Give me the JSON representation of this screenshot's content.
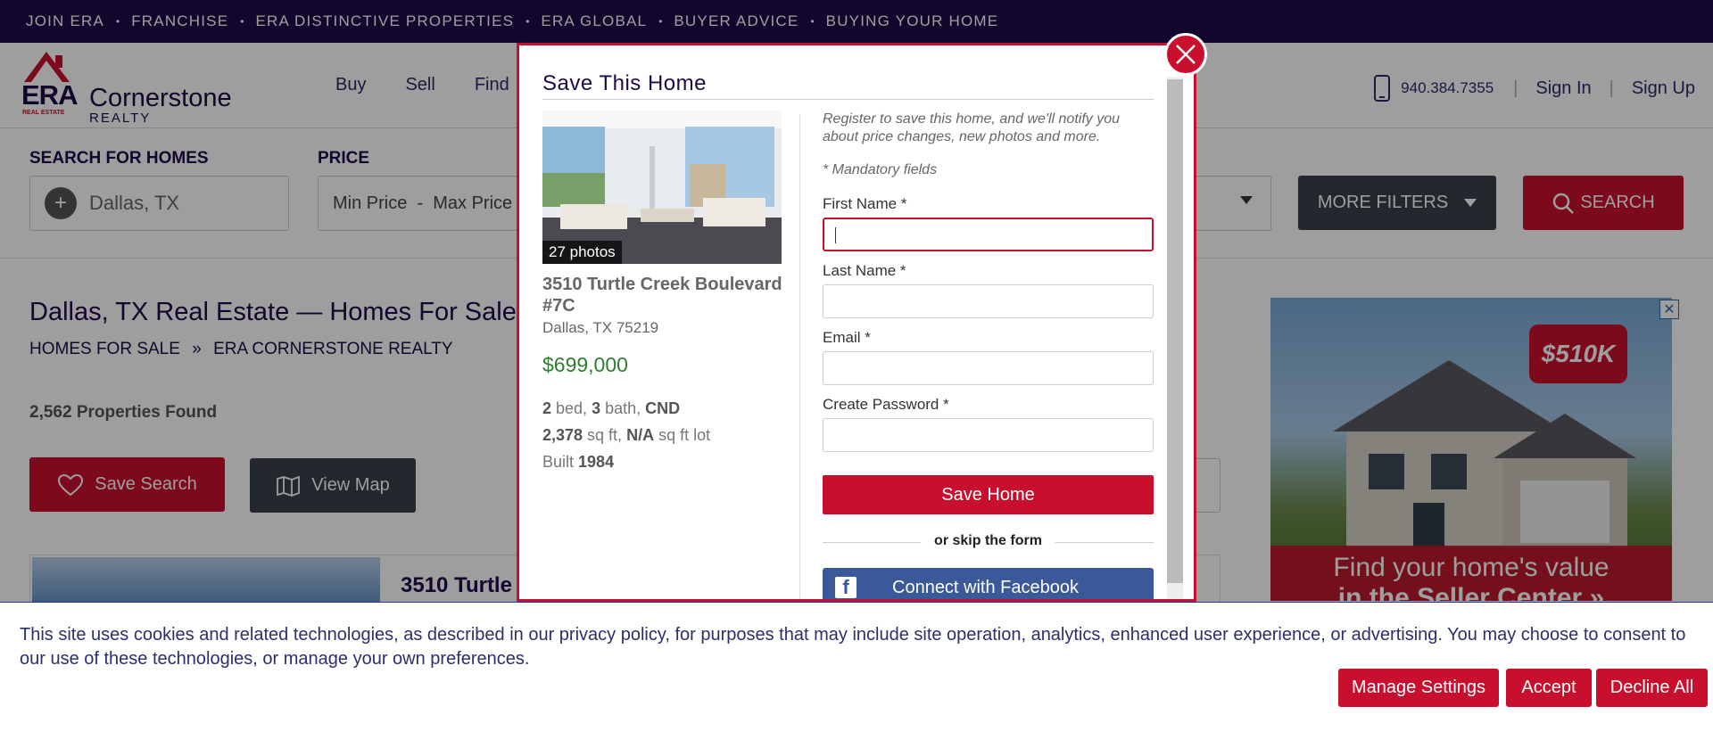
{
  "topbar": {
    "items": [
      "JOIN ERA",
      "FRANCHISE",
      "ERA DISTINCTIVE PROPERTIES",
      "ERA GLOBAL",
      "BUYER ADVICE",
      "BUYING YOUR HOME"
    ]
  },
  "header": {
    "logo_brand": "ERA",
    "logo_sub": "REAL ESTATE",
    "logo_name": "Cornerstone",
    "logo_realty": "REALTY",
    "nav": [
      "Buy",
      "Sell",
      "Find"
    ],
    "phone": "940.384.7355",
    "sign_in": "Sign In",
    "sign_up": "Sign Up"
  },
  "search": {
    "location_label": "SEARCH FOR HOMES",
    "location_value": "Dallas, TX",
    "price_label": "PRICE",
    "price_value": "Min Price  -  Max Price",
    "more_filters": "MORE FILTERS",
    "search_button": "SEARCH"
  },
  "results": {
    "title": "Dallas, TX Real Estate — Homes For Sale",
    "crumb1": "HOMES FOR SALE",
    "crumb_sep": "»",
    "crumb2": "ERA CORNERSTONE REALTY",
    "count": "2,562 Properties Found",
    "save_search": "Save Search",
    "view_map": "View Map",
    "card_title": "3510 Turtle"
  },
  "ad": {
    "price_tag": "$510K",
    "line1": "Find your home's value",
    "line2": "in the Seller Center »",
    "close": "✕"
  },
  "modal": {
    "title": "Save This Home",
    "photo_count": "27 photos",
    "address": "3510 Turtle Creek Boulevard #7C",
    "city": "Dallas, TX 75219",
    "price": "$699,000",
    "beds": "2",
    "beds_label": " bed, ",
    "baths": "3",
    "baths_label": " bath, ",
    "type": "CND",
    "sqft": "2,378",
    "sqft_label": " sq ft, ",
    "lot": "N/A",
    "lot_label": " sq ft lot",
    "built_label": "Built ",
    "built": "1984",
    "intro": "Register to save this home, and we'll notify you about price changes, new photos and more.",
    "mandatory": "* Mandatory fields",
    "first_name_label": "First Name *",
    "last_name_label": "Last Name *",
    "email_label": "Email *",
    "password_label": "Create Password *",
    "save_button": "Save Home",
    "skip_text": "or skip the form",
    "facebook": "Connect with Facebook"
  },
  "cookie": {
    "text": "This site uses cookies and related technologies, as described in our privacy policy, for purposes that may include site operation, analytics, enhanced user experience, or advertising. You may choose to consent to our use of these technologies, or manage your own preferences.",
    "manage": "Manage Settings",
    "accept": "Accept",
    "decline": "Decline All"
  },
  "colors": {
    "brand_red": "#c8102e",
    "brand_navy": "#1e0a47",
    "price_green": "#2e7d32",
    "facebook": "#3b5998"
  }
}
